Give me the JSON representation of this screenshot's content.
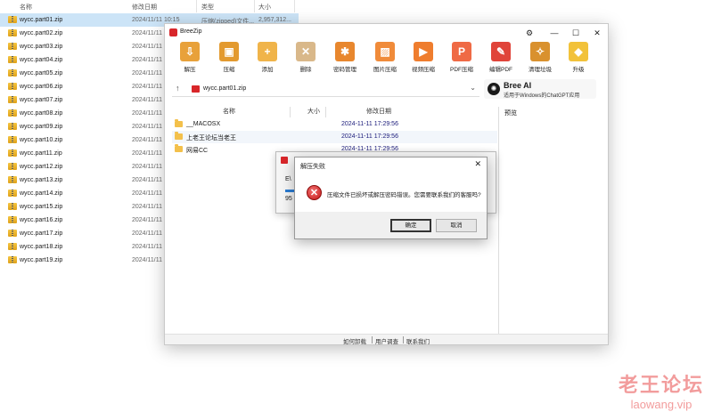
{
  "explorer": {
    "headers": {
      "name": "名称",
      "date": "修改日期",
      "type": "类型",
      "size": "大小"
    },
    "files": [
      {
        "name": "wycc.part01.zip",
        "date": "2024/11/11 10:15",
        "type": "压缩(zipped)文件...",
        "size": "2,957,312..."
      },
      {
        "name": "wycc.part02.zip",
        "date": "2024/11/11"
      },
      {
        "name": "wycc.part03.zip",
        "date": "2024/11/11"
      },
      {
        "name": "wycc.part04.zip",
        "date": "2024/11/11"
      },
      {
        "name": "wycc.part05.zip",
        "date": "2024/11/11"
      },
      {
        "name": "wycc.part06.zip",
        "date": "2024/11/11"
      },
      {
        "name": "wycc.part07.zip",
        "date": "2024/11/11"
      },
      {
        "name": "wycc.part08.zip",
        "date": "2024/11/11"
      },
      {
        "name": "wycc.part09.zip",
        "date": "2024/11/11"
      },
      {
        "name": "wycc.part10.zip",
        "date": "2024/11/11"
      },
      {
        "name": "wycc.part11.zip",
        "date": "2024/11/11"
      },
      {
        "name": "wycc.part12.zip",
        "date": "2024/11/11"
      },
      {
        "name": "wycc.part13.zip",
        "date": "2024/11/11"
      },
      {
        "name": "wycc.part14.zip",
        "date": "2024/11/11"
      },
      {
        "name": "wycc.part15.zip",
        "date": "2024/11/11"
      },
      {
        "name": "wycc.part16.zip",
        "date": "2024/11/11"
      },
      {
        "name": "wycc.part17.zip",
        "date": "2024/11/11"
      },
      {
        "name": "wycc.part18.zip",
        "date": "2024/11/11"
      },
      {
        "name": "wycc.part19.zip",
        "date": "2024/11/11"
      }
    ]
  },
  "window": {
    "title": "BreeZip",
    "controls": {
      "settings": "⚙",
      "minimize": "—",
      "maximize": "☐",
      "close": "✕"
    },
    "toolbar": [
      {
        "label": "解压",
        "icon": "extract-icon",
        "glyph": "⇩",
        "color": "#e8a13a"
      },
      {
        "label": "压缩",
        "icon": "compress-icon",
        "glyph": "▣",
        "color": "#e39a2f"
      },
      {
        "label": "添加",
        "icon": "add-icon",
        "glyph": "+",
        "color": "#f0b44a"
      },
      {
        "label": "删除",
        "icon": "delete-icon",
        "glyph": "✕",
        "color": "#d9b88a"
      },
      {
        "label": "密码管理",
        "icon": "password-icon",
        "glyph": "✱",
        "color": "#e8872e"
      },
      {
        "label": "图片压缩",
        "icon": "image-compress-icon",
        "glyph": "▨",
        "color": "#f08b3a"
      },
      {
        "label": "视频压缩",
        "icon": "video-compress-icon",
        "glyph": "▶",
        "color": "#ef7d2e"
      },
      {
        "label": "PDF压缩",
        "icon": "pdf-compress-icon",
        "glyph": "P",
        "color": "#ef6a45"
      },
      {
        "label": "编辑PDF",
        "icon": "edit-pdf-icon",
        "glyph": "✎",
        "color": "#e0443a"
      },
      {
        "label": "清理垃圾",
        "icon": "clean-icon",
        "glyph": "✧",
        "color": "#d9912e"
      },
      {
        "label": "升级",
        "icon": "upgrade-icon",
        "glyph": "◆",
        "color": "#f2c23a"
      }
    ],
    "address": {
      "path": "wycc.part01.zip"
    },
    "ai": {
      "title": "Bree AI",
      "subtitle": "适用于Windows的ChatGPT应用"
    },
    "columns": {
      "name": "名称",
      "size": "大小",
      "date": "修改日期"
    },
    "preview_label": "预览",
    "rows": [
      {
        "name": "__MACOSX",
        "date": "2024-11-11 17:29:56"
      },
      {
        "name": "上老王论坛当老王",
        "date": "2024-11-11 17:29:56"
      },
      {
        "name": "网易CC",
        "date": "2024-11-11 17:29:56"
      }
    ],
    "status": {
      "how": "如何卸载",
      "feedback": "用户调查",
      "contact": "联系我们"
    }
  },
  "progress": {
    "title": "",
    "line1": "E\\",
    "percent": "95"
  },
  "error_dialog": {
    "title": "解压失败",
    "message": "压缩文件已损坏或解压密码错误。您需要联系我们的客服吗?",
    "ok": "确定",
    "cancel": "取消"
  },
  "watermark": {
    "line1": "老王论坛",
    "line2": "laowang.vip"
  }
}
